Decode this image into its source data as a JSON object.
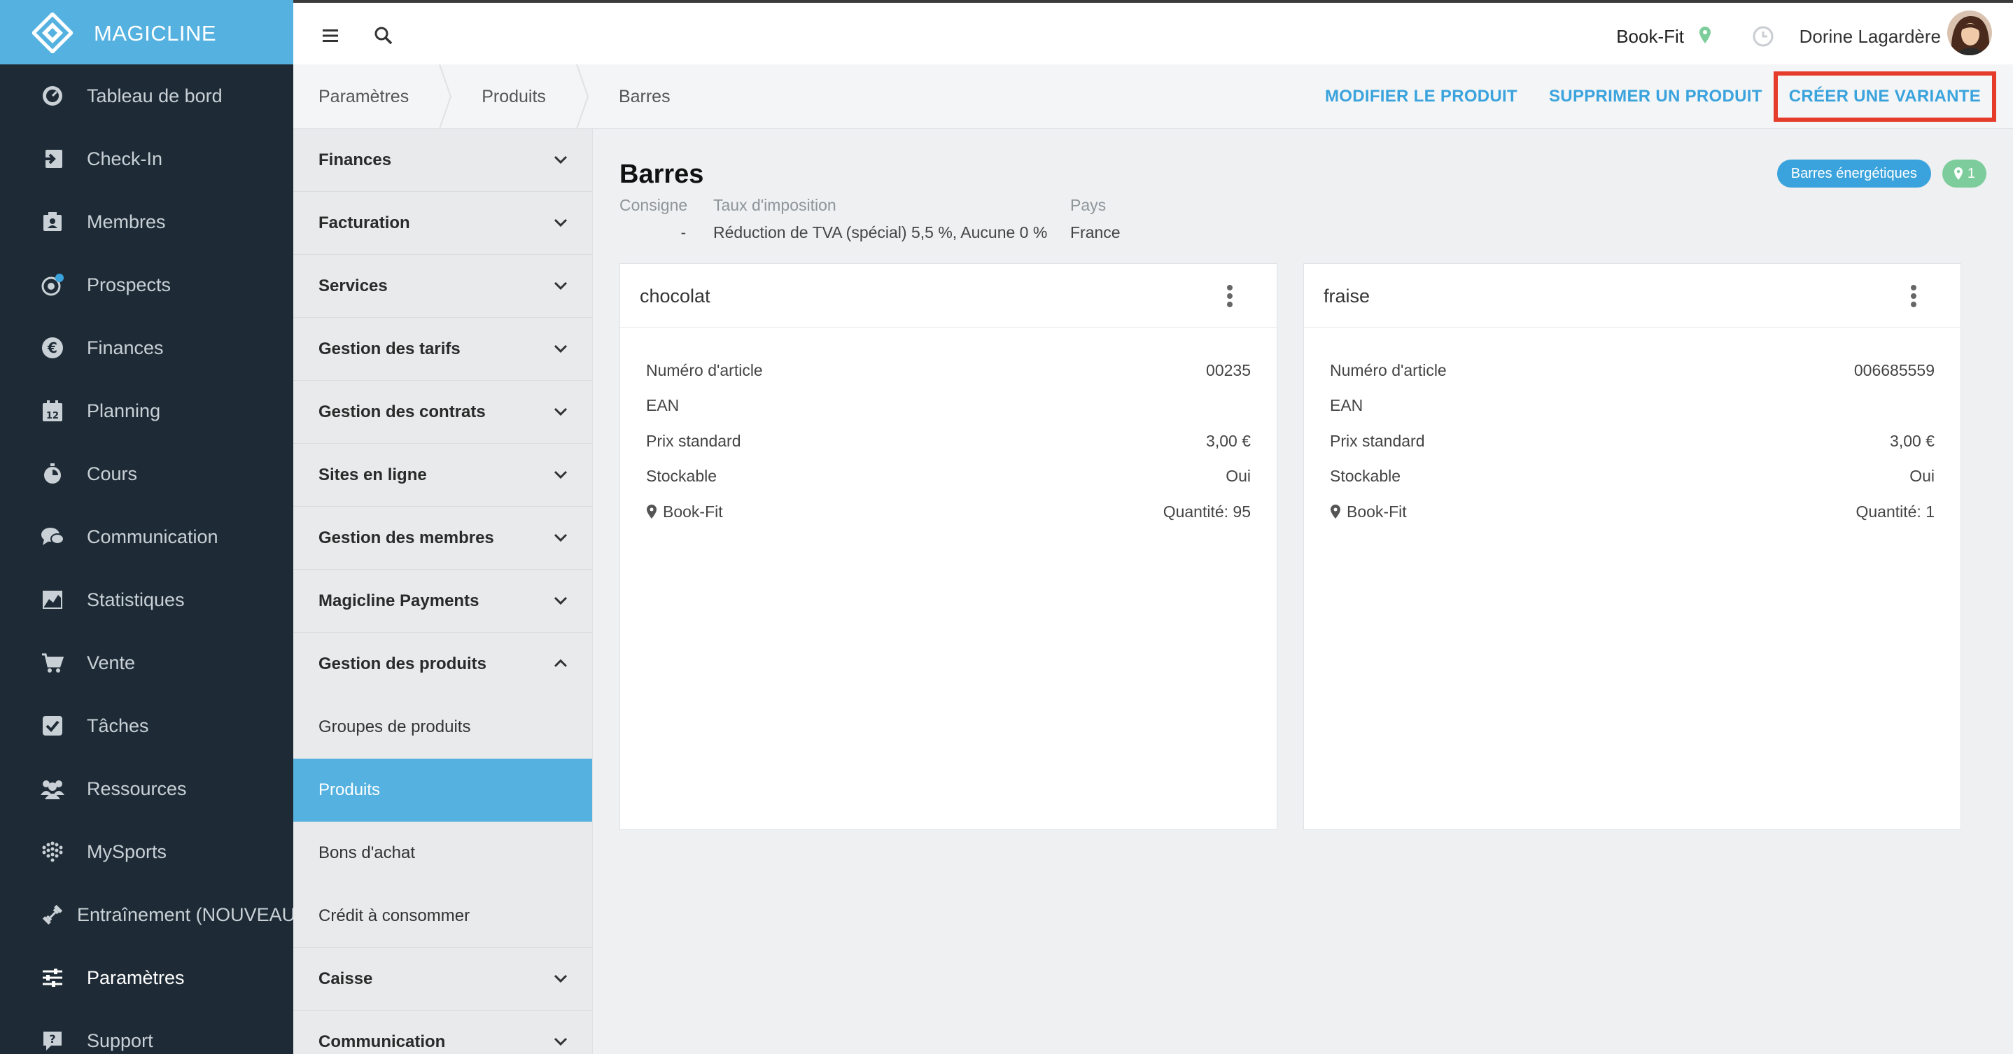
{
  "brand": {
    "name": "MAGICLINE"
  },
  "colors": {
    "accent": "#55b2e0",
    "nav_bg": "#1e2b36",
    "link": "#3aa3dd",
    "highlight_box": "#e53c2b",
    "location_badge": "#7ccd9b"
  },
  "sidebar": {
    "items": [
      {
        "label": "Tableau de bord",
        "icon": "dashboard-icon"
      },
      {
        "label": "Check-In",
        "icon": "check-in-icon"
      },
      {
        "label": "Membres",
        "icon": "members-icon"
      },
      {
        "label": "Prospects",
        "icon": "prospects-icon"
      },
      {
        "label": "Finances",
        "icon": "euro-icon"
      },
      {
        "label": "Planning",
        "icon": "calendar-icon"
      },
      {
        "label": "Cours",
        "icon": "stopwatch-icon"
      },
      {
        "label": "Communication",
        "icon": "chat-icon"
      },
      {
        "label": "Statistiques",
        "icon": "chart-icon"
      },
      {
        "label": "Vente",
        "icon": "cart-icon"
      },
      {
        "label": "Tâches",
        "icon": "checkbox-icon"
      },
      {
        "label": "Ressources",
        "icon": "people-icon"
      },
      {
        "label": "MySports",
        "icon": "dots-grid-icon"
      },
      {
        "label": "Entraînement (NOUVEAU)",
        "icon": "dumbbell-icon"
      },
      {
        "label": "Paramètres",
        "icon": "sliders-icon",
        "active": true
      },
      {
        "label": "Support",
        "icon": "help-icon"
      }
    ]
  },
  "topbar": {
    "site": "Book-Fit",
    "user": "Dorine Lagardère"
  },
  "breadcrumb": [
    "Paramètres",
    "Produits",
    "Barres"
  ],
  "actions": {
    "edit": "MODIFIER LE PRODUIT",
    "delete": "SUPPRIMER UN PRODUIT",
    "create_variant": "CRÉER UNE VARIANTE"
  },
  "submenu": {
    "sections": [
      {
        "label": "Finances",
        "expanded": false
      },
      {
        "label": "Facturation",
        "expanded": false
      },
      {
        "label": "Services",
        "expanded": false
      },
      {
        "label": "Gestion des tarifs",
        "expanded": false
      },
      {
        "label": "Gestion des contrats",
        "expanded": false
      },
      {
        "label": "Sites en ligne",
        "expanded": false
      },
      {
        "label": "Gestion des membres",
        "expanded": false
      },
      {
        "label": "Magicline Payments",
        "expanded": false
      },
      {
        "label": "Gestion des produits",
        "expanded": true
      },
      {
        "label": "Caisse",
        "expanded": false
      },
      {
        "label": "Communication",
        "expanded": false
      }
    ],
    "product_items": [
      {
        "label": "Groupes de produits"
      },
      {
        "label": "Produits",
        "active": true
      },
      {
        "label": "Bons d'achat"
      },
      {
        "label": "Crédit à consommer"
      }
    ]
  },
  "product": {
    "title": "Barres",
    "group_tag": "Barres énergétiques",
    "location_count": "1",
    "meta": {
      "deposit_label": "Consigne",
      "deposit_value": "-",
      "tax_label": "Taux d'imposition",
      "tax_value": "Réduction de TVA (spécial) 5,5 %, Aucune 0 %",
      "country_label": "Pays",
      "country_value": "France"
    },
    "labels": {
      "article": "Numéro d'article",
      "ean": "EAN",
      "price": "Prix standard",
      "stockable": "Stockable"
    },
    "variants": [
      {
        "name": "chocolat",
        "article": "00235",
        "ean": "",
        "price": "3,00 €",
        "stockable": "Oui",
        "site": "Book-Fit",
        "quantity": "Quantité: 95"
      },
      {
        "name": "fraise",
        "article": "006685559",
        "ean": "",
        "price": "3,00 €",
        "stockable": "Oui",
        "site": "Book-Fit",
        "quantity": "Quantité: 1"
      }
    ]
  }
}
